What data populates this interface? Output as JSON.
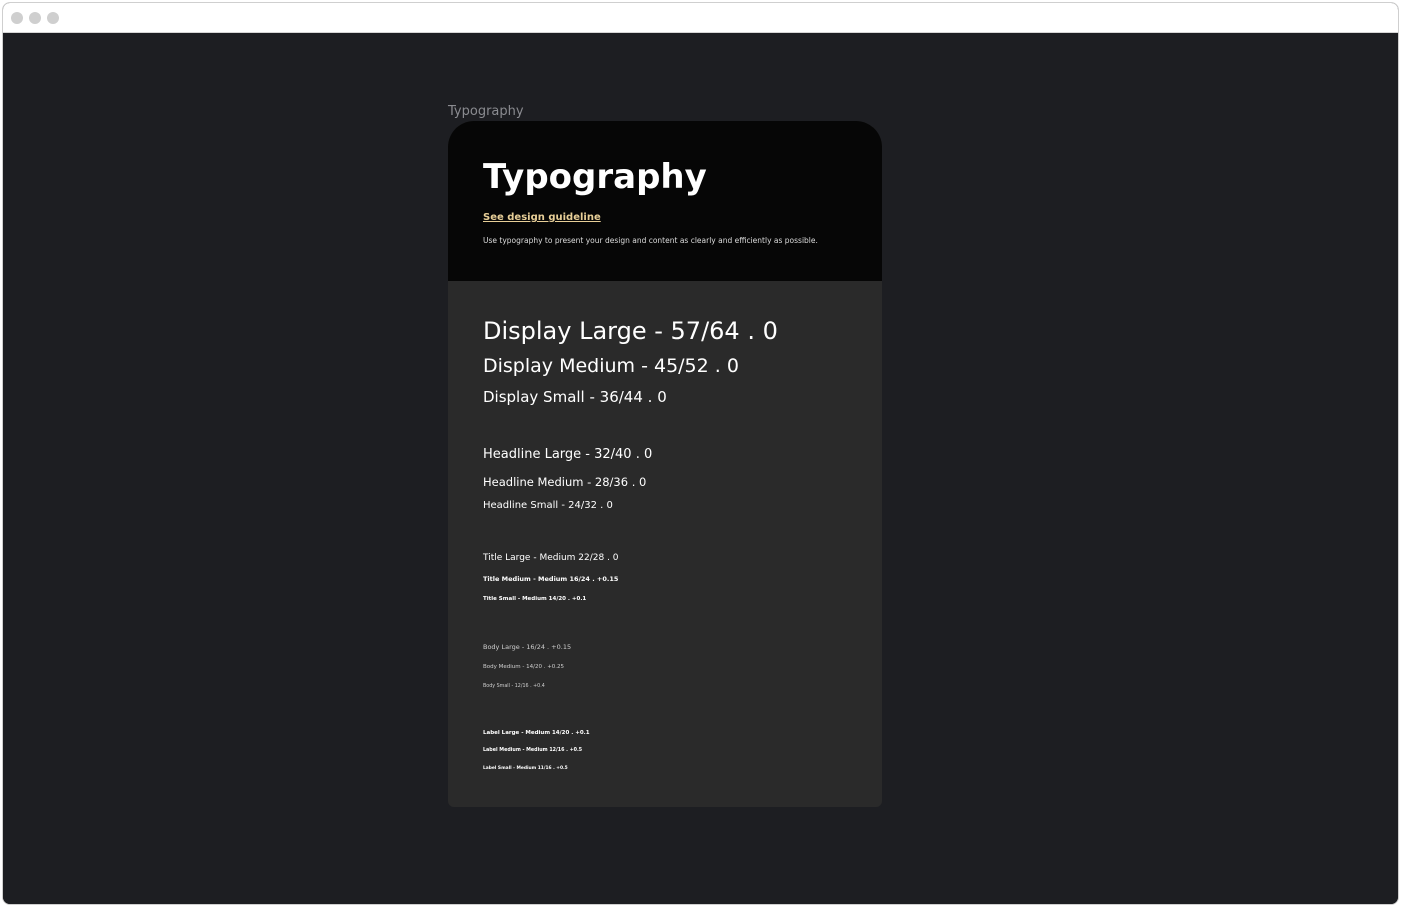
{
  "canvas": {
    "frame_label": "Typography"
  },
  "card": {
    "title": "Typography",
    "guideline_link": "See design guideline",
    "description": "Use typography to present your design and content as clearly and efficiently as possible."
  },
  "type_scale": [
    {
      "id": "display-large",
      "label": "Display Large - 57/64 . 0"
    },
    {
      "id": "display-medium",
      "label": "Display Medium - 45/52 .  0"
    },
    {
      "id": "display-small",
      "label": "Display Small - 36/44 . 0"
    },
    {
      "id": "headline-large",
      "label": "Headline Large - 32/40 . 0"
    },
    {
      "id": "headline-medium",
      "label": "Headline Medium - 28/36 . 0"
    },
    {
      "id": "headline-small",
      "label": "Headline Small - 24/32 . 0"
    },
    {
      "id": "title-large",
      "label": "Title Large - Medium 22/28 . 0"
    },
    {
      "id": "title-medium",
      "label": "Title Medium - Medium 16/24 . +0.15"
    },
    {
      "id": "title-small",
      "label": "Title Small - Medium 14/20 . +0.1"
    },
    {
      "id": "body-large",
      "label": "Body Large - 16/24 . +0.15"
    },
    {
      "id": "body-medium",
      "label": "Body Medium - 14/20 . +0.25"
    },
    {
      "id": "body-small",
      "label": "Body Small - 12/16 . +0.4"
    },
    {
      "id": "label-large",
      "label": "Label Large - Medium 14/20 . +0.1"
    },
    {
      "id": "label-medium",
      "label": "Label Medium - Medium 12/16 . +0.5"
    },
    {
      "id": "label-small",
      "label": "Label Small - Medium 11/16 . +0.5"
    }
  ],
  "colors": {
    "canvas_bg": "#1d1e22",
    "card_body": "#2a2a2a",
    "card_header": "#060606",
    "link": "#e8cf98"
  }
}
